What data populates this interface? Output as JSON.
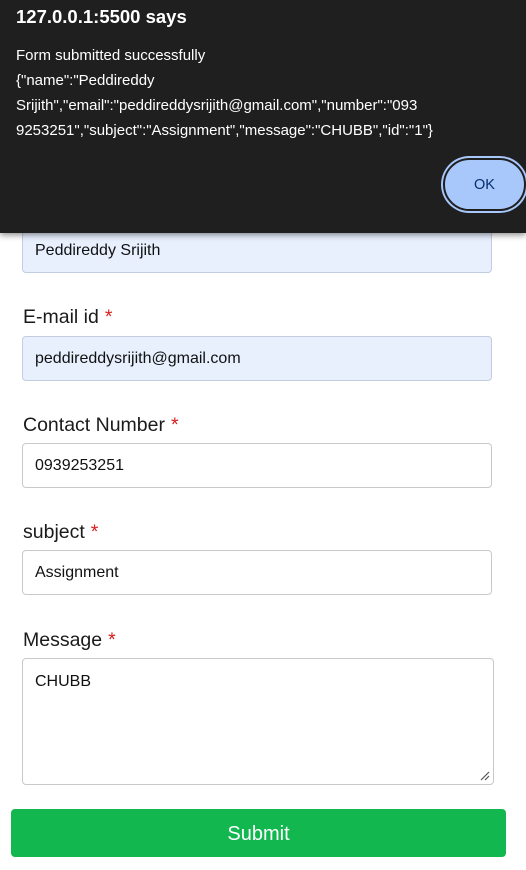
{
  "dialog": {
    "title": "127.0.0.1:5500 says",
    "message_lines": [
      "Form submitted successfully",
      "{\"name\":\"Peddireddy",
      "Srijith\",\"email\":\"peddireddysrijith@gmail.com\",\"number\":\"093",
      "9253251\",\"subject\":\"Assignment\",\"message\":\"CHUBB\",\"id\":\"1\"}"
    ],
    "ok_label": "OK"
  },
  "form": {
    "name": {
      "value": "Peddireddy Srijith"
    },
    "email": {
      "label": "E-mail id",
      "required_mark": "*",
      "value": "peddireddysrijith@gmail.com"
    },
    "number": {
      "label": "Contact Number",
      "required_mark": "*",
      "value": "0939253251"
    },
    "subject": {
      "label": "subject",
      "required_mark": "*",
      "value": "Assignment"
    },
    "message": {
      "label": "Message",
      "required_mark": "*",
      "value": "CHUBB"
    },
    "submit_label": "Submit"
  },
  "colors": {
    "submit_bg": "#12b84f",
    "required_star": "#d92020",
    "autofill_bg": "#e8f0fe",
    "dialog_bg": "#1f1f1f",
    "ok_bg": "#a8c7fa"
  }
}
